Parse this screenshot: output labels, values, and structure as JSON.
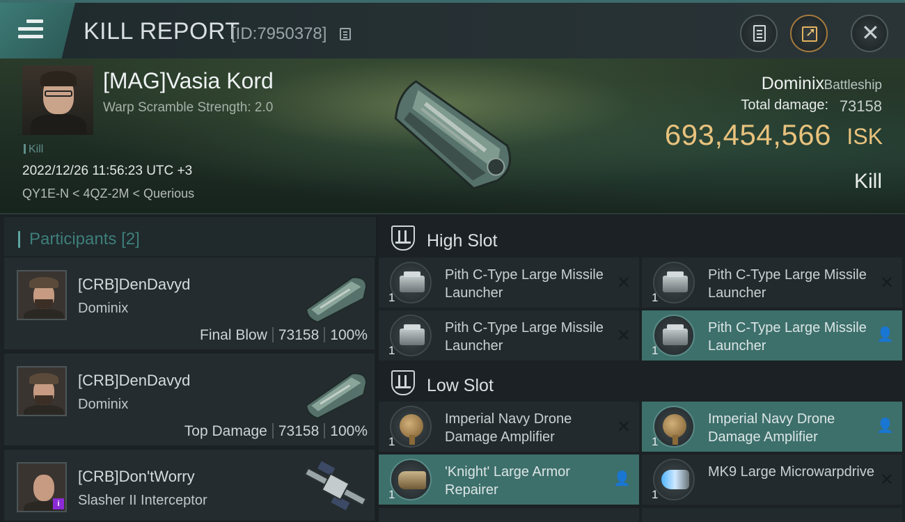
{
  "header": {
    "title": "KILL REPORT",
    "id_label": "[ID:7950378]"
  },
  "victim": {
    "name": "[MAG]Vasia Kord",
    "warp_scramble": "Warp Scramble Strength: 2.0",
    "tag": "Kill",
    "time": "2022/12/26 11:56:23 UTC +3",
    "location": "QY1E-N < 4QZ-2M < Querious",
    "ship_name": "Dominix",
    "ship_class": "Battleship",
    "total_damage_label": "Total damage:",
    "total_damage": "73158",
    "isk_value": "693,454,566",
    "isk_unit": "ISK",
    "status": "Kill"
  },
  "participants": {
    "title": "Participants",
    "count": "[2]",
    "items": [
      {
        "name": "[CRB]DenDavyd",
        "ship": "Dominix",
        "role": "Final Blow",
        "damage": "73158",
        "percent": "100%"
      },
      {
        "name": "[CRB]DenDavyd",
        "ship": "Dominix",
        "role": "Top Damage",
        "damage": "73158",
        "percent": "100%"
      },
      {
        "name": "[CRB]Don'tWorry",
        "ship": "Slasher II Interceptor",
        "badge": "i"
      }
    ]
  },
  "modules": {
    "high_slot_label": "High Slot",
    "low_slot_label": "Low Slot",
    "high": [
      {
        "name": "Pith C-Type Large Missile Launcher",
        "qty": "1",
        "state": "destroyed"
      },
      {
        "name": "Pith C-Type Large Missile Launcher",
        "qty": "1",
        "state": "destroyed"
      },
      {
        "name": "Pith C-Type Large Missile Launcher",
        "qty": "1",
        "state": "destroyed"
      },
      {
        "name": "Pith C-Type Large Missile Launcher",
        "qty": "1",
        "state": "dropped"
      }
    ],
    "low": [
      {
        "name": "Imperial Navy Drone Damage Amplifier",
        "qty": "1",
        "state": "destroyed"
      },
      {
        "name": "Imperial Navy Drone Damage Amplifier",
        "qty": "1",
        "state": "dropped"
      },
      {
        "name": "'Knight' Large Armor Repairer",
        "qty": "1",
        "state": "dropped"
      },
      {
        "name": "MK9 Large Microwarpdrive",
        "qty": "1",
        "state": "destroyed"
      }
    ]
  },
  "colors": {
    "accent_teal": "#3d6f6b",
    "isk_gold": "#e8c27d",
    "header_teal": "#3d7b76"
  }
}
